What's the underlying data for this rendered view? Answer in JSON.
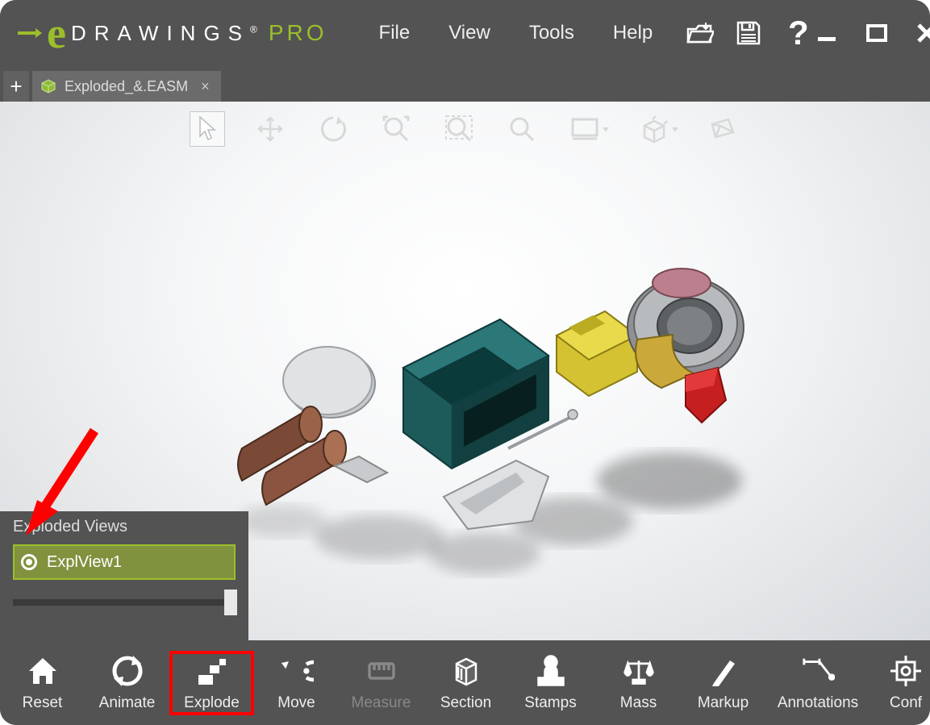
{
  "app": {
    "name_part1": "DRAWINGS",
    "name_part2": "PRO"
  },
  "menu": {
    "file": "File",
    "view": "View",
    "tools": "Tools",
    "help": "Help"
  },
  "tab": {
    "label": "Exploded_&.EASM"
  },
  "view_toolbar": {
    "items": [
      "select",
      "pan",
      "rotate",
      "zoom-to-fit",
      "zoom-area",
      "zoom",
      "display-style",
      "view-orientation",
      "perspective"
    ]
  },
  "exploded_panel": {
    "title": "Exploded Views",
    "item": "ExplView1",
    "slider_value": 100
  },
  "bottom_nav": {
    "reset": "Reset",
    "animate": "Animate",
    "explode": "Explode",
    "move": "Move",
    "measure": "Measure",
    "section": "Section",
    "stamps": "Stamps",
    "mass": "Mass",
    "markup": "Markup",
    "annotations": "Annotations",
    "conf": "Conf"
  }
}
